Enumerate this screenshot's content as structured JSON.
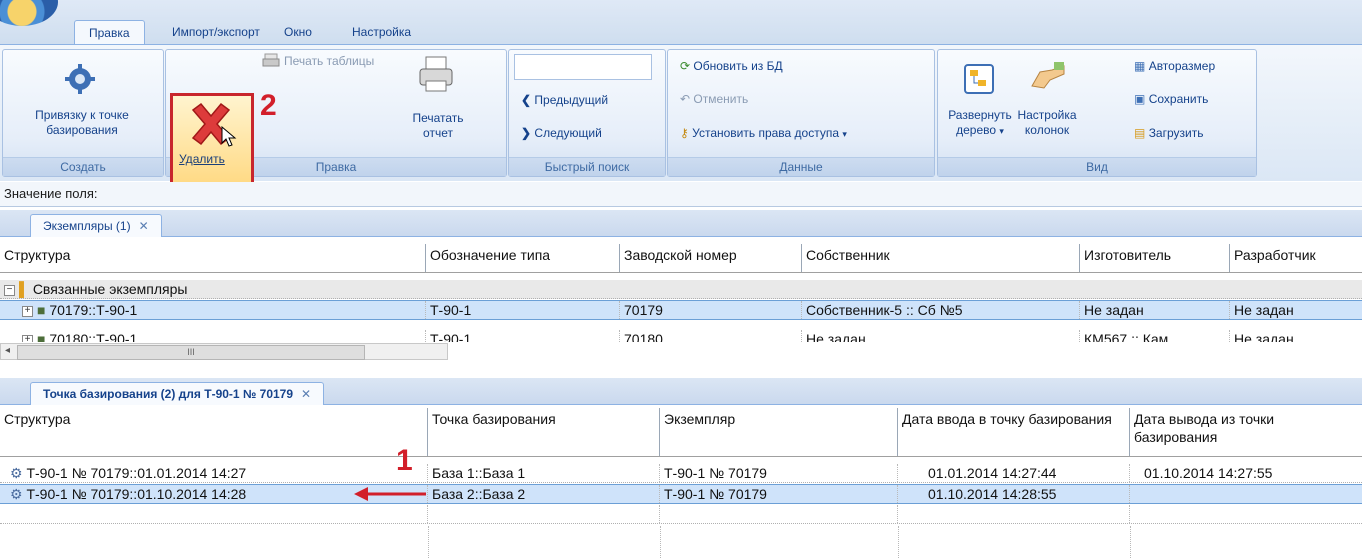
{
  "ribbon": {
    "tabs": [
      "Правка",
      "Импорт/экспорт",
      "Окно",
      "Настройка"
    ],
    "active_tab": "Правка",
    "groups": {
      "create": {
        "label": "Создать",
        "bind_button": "Привязку к точке базирования"
      },
      "edit": {
        "label": "Правка",
        "delete_button": "Удалить",
        "print_table": "Печать таблицы",
        "print_report_line1": "Печатать",
        "print_report_line2": "отчет"
      },
      "quick_search": {
        "label": "Быстрый поиск",
        "search_value": "",
        "prev": "Предыдущий",
        "next": "Следующий"
      },
      "data": {
        "label": "Данные",
        "refresh": "Обновить из БД",
        "cancel": "Отменить",
        "set_access": "Установить права доступа"
      },
      "view": {
        "label": "Вид",
        "expand_line1": "Развернуть",
        "expand_line2": "дерево",
        "columns_line1": "Настройка",
        "columns_line2": "колонок",
        "autosize": "Авторазмер",
        "save": "Сохранить",
        "load": "Загрузить"
      }
    },
    "annotation_step2": "2"
  },
  "field_bar": {
    "label": "Значение поля:"
  },
  "top_panel": {
    "tab_title": "Экземпляры (1)",
    "columns": [
      "Структура",
      "Обозначение типа",
      "Заводской номер",
      "Собственник",
      "Изготовитель",
      "Разработчик"
    ],
    "group_label": "Связанные экземпляры",
    "rows": [
      [
        "70179::Т-90-1",
        "Т-90-1",
        "70179",
        "Собственник-5 :: Сб №5",
        "Не задан",
        "Не задан"
      ],
      [
        "70180::Т-90-1",
        "Т-90-1",
        "70180",
        "Не задан",
        "КМ567 :: Кам",
        "Не задан"
      ]
    ],
    "scroll_mark": "III"
  },
  "bottom_panel": {
    "tab_title": "Точка базирования (2) для Т-90-1  № 70179",
    "columns": [
      "Структура",
      "Точка базирования",
      "Экземпляр",
      "Дата ввода в точку базирования",
      "Дата вывода из точки базирования"
    ],
    "rows": [
      [
        "Т-90-1  № 70179::01.01.2014 14:27",
        "База 1::База 1",
        "Т-90-1  № 70179",
        "01.01.2014 14:27:44",
        "01.10.2014 14:27:55"
      ],
      [
        "Т-90-1  № 70179::01.10.2014 14:28",
        "База 2::База 2",
        "Т-90-1  № 70179",
        "01.10.2014 14:28:55",
        ""
      ]
    ],
    "annotation_step1": "1"
  },
  "colors": {
    "accent": "#15428b",
    "selection": "#cfe3fa",
    "annotation": "#d21f2a"
  }
}
